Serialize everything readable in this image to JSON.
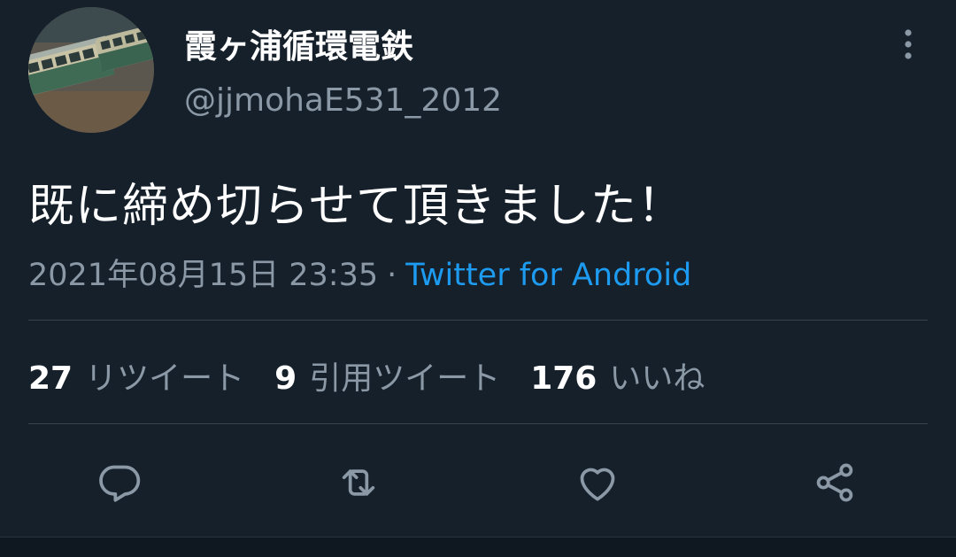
{
  "user": {
    "display_name": "霞ヶ浦循環電鉄",
    "handle": "@jjmohaE531_2012"
  },
  "tweet": {
    "text": "既に締め切らせて頂きました！",
    "timestamp": "2021年08月15日 23:35",
    "separator": "·",
    "source": "Twitter for Android"
  },
  "stats": {
    "retweets": {
      "count": "27",
      "label": "リツイート"
    },
    "quotes": {
      "count": "9",
      "label": "引用ツイート"
    },
    "likes": {
      "count": "176",
      "label": "いいね"
    }
  },
  "icons": {
    "more": "more-vertical-icon",
    "reply": "reply-icon",
    "retweet": "retweet-icon",
    "like": "heart-icon",
    "share": "share-icon"
  },
  "colors": {
    "background": "#15202b",
    "secondary_text": "#8b98a5",
    "link": "#1d9bf0",
    "divider": "#38444d"
  }
}
